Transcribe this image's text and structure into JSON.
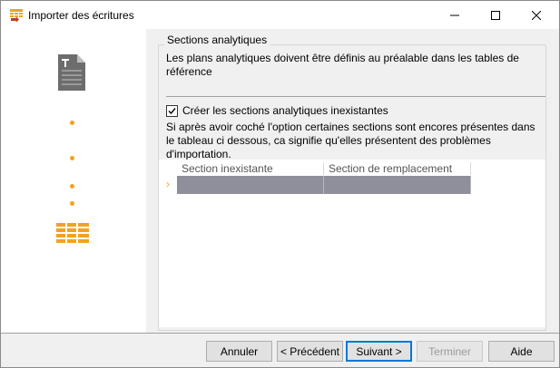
{
  "window": {
    "title": "Importer des écritures"
  },
  "group": {
    "title": "Sections analytiques",
    "info": "Les plans analytiques doivent être définis au préalable dans les tables de référence"
  },
  "checkbox": {
    "label": "Créer les sections analytiques inexistantes",
    "checked": true
  },
  "description": "Si après avoir coché l'option certaines sections sont encores présentes dans le tableau ci dessous, ca signifie qu'elles présentent des problèmes d'importation.",
  "grid": {
    "columns": [
      "Section inexistante",
      "Section de remplacement"
    ],
    "row_indicator": "›",
    "rows": [
      [
        "",
        ""
      ]
    ]
  },
  "buttons": {
    "cancel": "Annuler",
    "previous": "< Précédent",
    "next": "Suivant >",
    "finish": "Terminer",
    "help": "Aide"
  },
  "colors": {
    "accent": "#f4a21d",
    "selected_row": "#8f8f9b",
    "primary_border": "#0078d7"
  }
}
